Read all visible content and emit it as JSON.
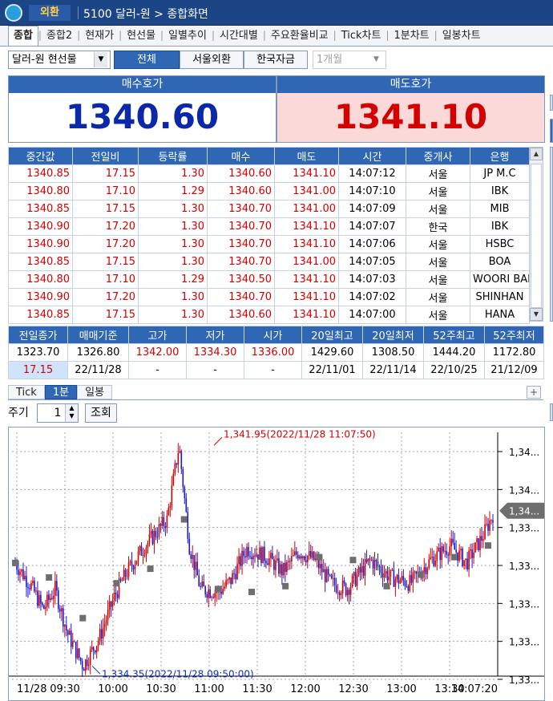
{
  "titlebar": {
    "badge": "외환",
    "title": "5100 달러-원 > 종합화면"
  },
  "tabs": [
    "종합",
    "종합2",
    "현재가",
    "현선물",
    "일별추이",
    "시간대별",
    "주요환율비교",
    "Tick차트",
    "1분차트",
    "일봉차트"
  ],
  "filter": {
    "product": "달러-원 현선물",
    "segments": [
      "전체",
      "서울외환",
      "한국자금"
    ],
    "active_segment": "전체",
    "month": "1개월"
  },
  "quote": {
    "bid_label": "매수호가",
    "bid_value": "1340.60",
    "ask_label": "매도호가",
    "ask_value": "1341.10"
  },
  "ticks_table": {
    "columns": [
      "중간값",
      "전일비",
      "등락률",
      "매수",
      "매도",
      "시간",
      "중개사",
      "은행"
    ],
    "rows": [
      [
        "1340.85",
        "17.15",
        "1.30",
        "1340.60",
        "1341.10",
        "14:07:12",
        "서울",
        "JP M.C"
      ],
      [
        "1340.80",
        "17.10",
        "1.29",
        "1340.60",
        "1341.00",
        "14:07:10",
        "서울",
        "IBK"
      ],
      [
        "1340.85",
        "17.15",
        "1.30",
        "1340.70",
        "1341.00",
        "14:07:09",
        "서울",
        "MIB"
      ],
      [
        "1340.90",
        "17.20",
        "1.30",
        "1340.70",
        "1341.10",
        "14:07:07",
        "한국",
        "IBK"
      ],
      [
        "1340.90",
        "17.20",
        "1.30",
        "1340.70",
        "1341.10",
        "14:07:06",
        "서울",
        "HSBC"
      ],
      [
        "1340.85",
        "17.15",
        "1.30",
        "1340.70",
        "1341.00",
        "14:07:05",
        "서울",
        "BOA"
      ],
      [
        "1340.80",
        "17.10",
        "1.29",
        "1340.50",
        "1341.10",
        "14:07:03",
        "서울",
        "WOORI BANI"
      ],
      [
        "1340.90",
        "17.20",
        "1.30",
        "1340.70",
        "1341.10",
        "14:07:02",
        "서울",
        "SHINHAN"
      ],
      [
        "1340.85",
        "17.15",
        "1.30",
        "1340.60",
        "1341.10",
        "14:07:00",
        "서울",
        "HANA"
      ]
    ]
  },
  "summary": {
    "columns": [
      "전일종가",
      "매매기준",
      "고가",
      "저가",
      "시가",
      "20일최고",
      "20일최저",
      "52주최고",
      "52주최저"
    ],
    "row1": [
      "1323.70",
      "1326.80",
      "1342.00",
      "1334.30",
      "1336.00",
      "1429.60",
      "1308.50",
      "1444.20",
      "1172.80"
    ],
    "row2": [
      "17.15",
      "22/11/28",
      "-",
      "-",
      "-",
      "22/11/01",
      "22/11/14",
      "22/10/25",
      "21/12/09"
    ]
  },
  "chart_tabs": [
    "Tick",
    "1분",
    "일봉"
  ],
  "chart_tabs_active": "1분",
  "period": {
    "label": "주기",
    "value": "1",
    "button": "조회"
  },
  "chart_data": {
    "type": "candlestick",
    "x_tick_labels": [
      "11/28",
      "09:30",
      "10:00",
      "10:30",
      "11:00",
      "11:30",
      "12:00",
      "12:30",
      "13:00",
      "13:30",
      "14:07:20"
    ],
    "y_tick_labels": [
      "1,34...",
      "1,34...",
      "1,33...",
      "1,33...",
      "1,33...",
      "1,33...",
      "1,33..."
    ],
    "current_price_label": "1,34...",
    "high_annotation": "1,341.95(2022/11/28 11:07:50)",
    "low_annotation": "1,334.35(2022/11/28 09:50:00)",
    "y_range": [
      1334.0,
      1342.4
    ],
    "high": 1341.95,
    "low": 1334.35,
    "up_color": "#d40000",
    "down_color": "#1a1ad0",
    "markers": [
      1337.9,
      1337.4,
      1336.0,
      1337.2,
      1337.7,
      1339.4,
      1337.0,
      1336.9,
      1337.1,
      1338.1,
      1338.0,
      1337.1,
      1337.5,
      1338.1,
      1338.5
    ]
  }
}
